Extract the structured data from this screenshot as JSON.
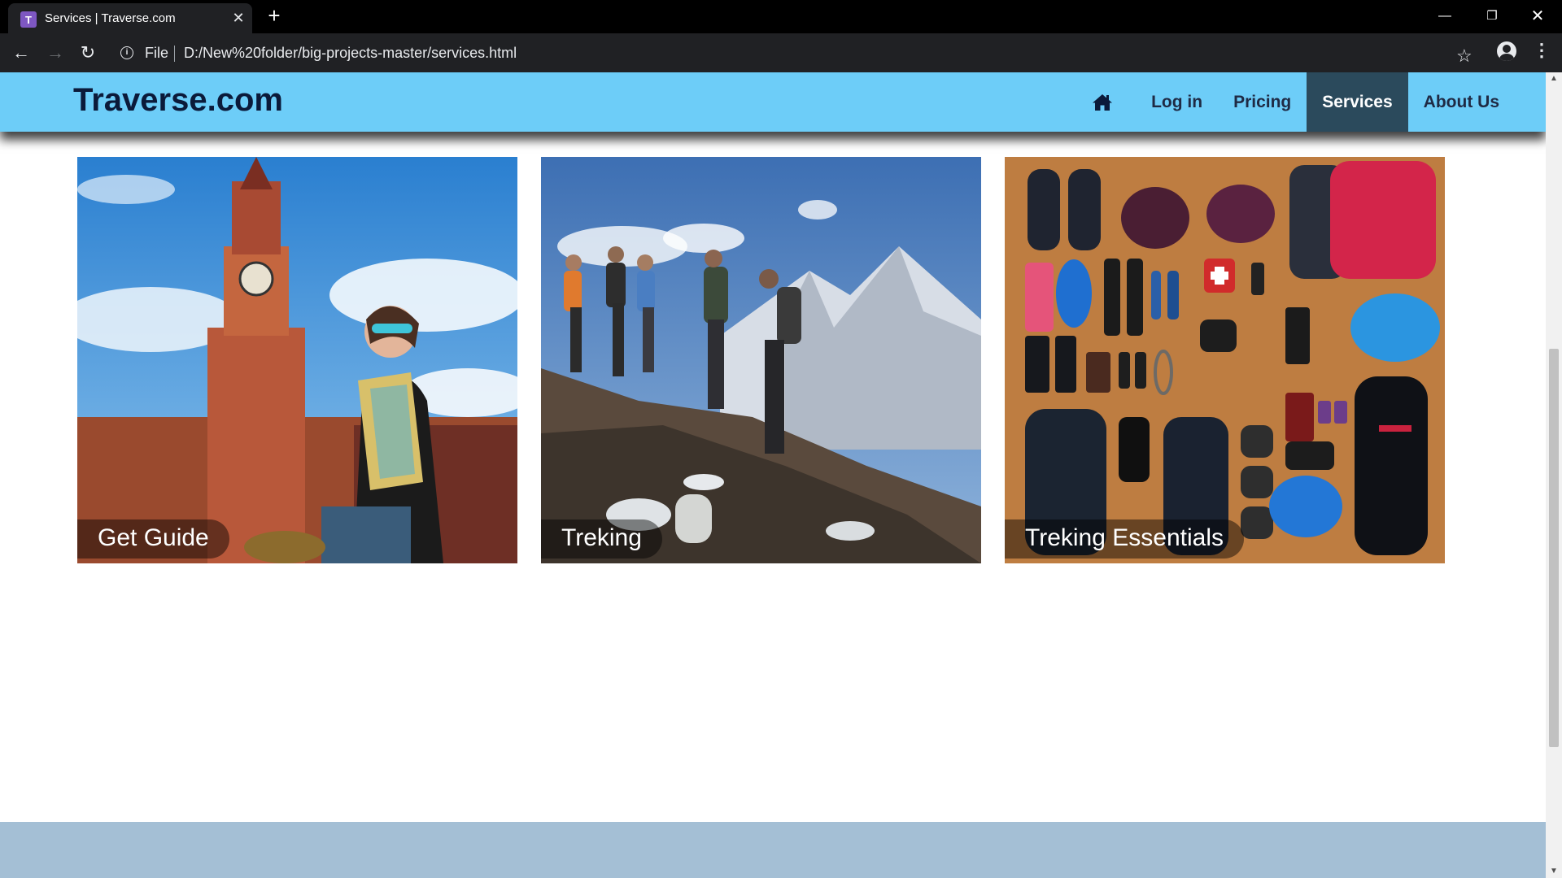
{
  "browser": {
    "tab_title": "Services | Traverse.com",
    "favicon_letter": "T",
    "file_label": "File",
    "url": "D:/New%20folder/big-projects-master/services.html"
  },
  "site": {
    "brand": "Traverse.com",
    "nav": [
      {
        "icon": "home-icon"
      },
      {
        "label": "Log in"
      },
      {
        "label": "Pricing"
      },
      {
        "label": "Services",
        "active": true
      },
      {
        "label": "About Us"
      }
    ]
  },
  "cards": [
    {
      "label": "Get Guide"
    },
    {
      "label": "Treking"
    },
    {
      "label": "Treking Essentials"
    }
  ],
  "colors": {
    "header_bg": "#6dcdf8",
    "active_nav_bg": "#2b4a5c",
    "footer_bg": "#a4bfd5"
  }
}
